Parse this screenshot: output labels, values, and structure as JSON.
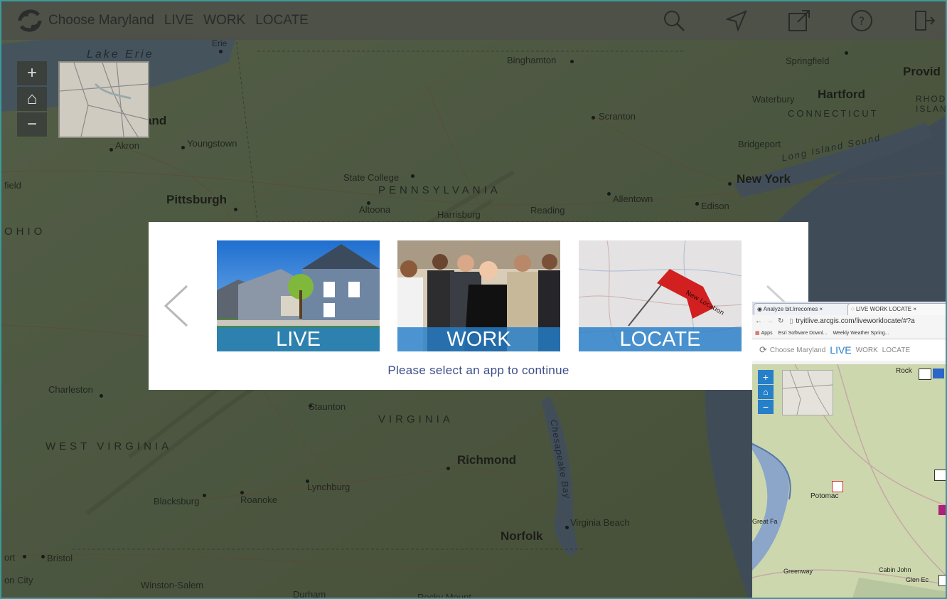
{
  "header": {
    "brand": "Choose Maryland",
    "links": [
      "LIVE",
      "WORK",
      "LOCATE"
    ],
    "icons": [
      "search-icon",
      "locate-arrow-icon",
      "share-icon",
      "help-icon",
      "exit-icon"
    ]
  },
  "map_controls": {
    "zoom_in": "+",
    "home": "⌂",
    "zoom_out": "−"
  },
  "map_labels": {
    "lake_erie": "Lake Erie",
    "erie": "Erie",
    "binghamton": "Binghamton",
    "springfield": "Springfield",
    "providence": "Provid",
    "waterbury": "Waterbury",
    "hartford": "Hartford",
    "connecticut": "CONNECTICUT",
    "rhode_island": "RHODE ISLAND",
    "scranton": "Scranton",
    "bridgeport": "Bridgeport",
    "long_island_sound": "Long Island Sound",
    "new_york": "New York",
    "akron": "Akron",
    "youngstown": "Youngstown",
    "cleveland_partial": "and",
    "state_college": "State College",
    "pennsylvania": "PENNSYLVANIA",
    "allentown": "Allentown",
    "edison": "Edison",
    "pittsburgh": "Pittsburgh",
    "altoona": "Altoona",
    "harrisburg": "Harrisburg",
    "reading": "Reading",
    "mansfield_partial": "field",
    "ohio": "OHIO",
    "charleston": "Charleston",
    "staunton": "Staunton",
    "virginia": "VIRGINIA",
    "west_virginia": "WEST VIRGINIA",
    "richmond": "Richmond",
    "chesapeake_bay": "Chesapeake Bay",
    "lynchburg": "Lynchburg",
    "blacksburg": "Blacksburg",
    "roanoke": "Roanoke",
    "virginia_beach": "Virginia Beach",
    "norfolk": "Norfolk",
    "bristol": "Bristol",
    "port_partial": "ort",
    "city_partial": "on City",
    "winston_salem": "Winston-Salem",
    "durham": "Durham",
    "rocky_mount": "Rocky Mount"
  },
  "modal": {
    "cards": [
      {
        "label": "LIVE",
        "image": "house-photo"
      },
      {
        "label": "WORK",
        "image": "business-people-photo"
      },
      {
        "label": "LOCATE",
        "image": "map-flag-photo"
      }
    ],
    "prompt": "Please select an app to continue",
    "flag_text": "New Location"
  },
  "inset_browser": {
    "tabs": [
      "Analyze bit.lrrecomes",
      "LIVE WORK LOCATE"
    ],
    "tab_close": "×",
    "url": "tryitlive.arcgis.com/liveworklocate/#?a",
    "bookmarks": [
      "Apps",
      "Esri Software Downl...",
      "Weekly Weather Spring..."
    ],
    "brand": "Choose Maryland",
    "links": [
      "LIVE",
      "WORK",
      "LOCATE"
    ],
    "map_labels": {
      "rockville_partial": "Rock",
      "potomac": "Potomac",
      "great_falls_partial": "Great Fa",
      "greenway": "Greenway",
      "cabin_john": "Cabin John",
      "glen_echo_partial": "Glen Ec"
    }
  },
  "colors": {
    "accent_blue": "#267fc9",
    "header_bg": "#4e5048",
    "prompt_text": "#3c4d8a",
    "frame_border": "#3b9a9c"
  }
}
